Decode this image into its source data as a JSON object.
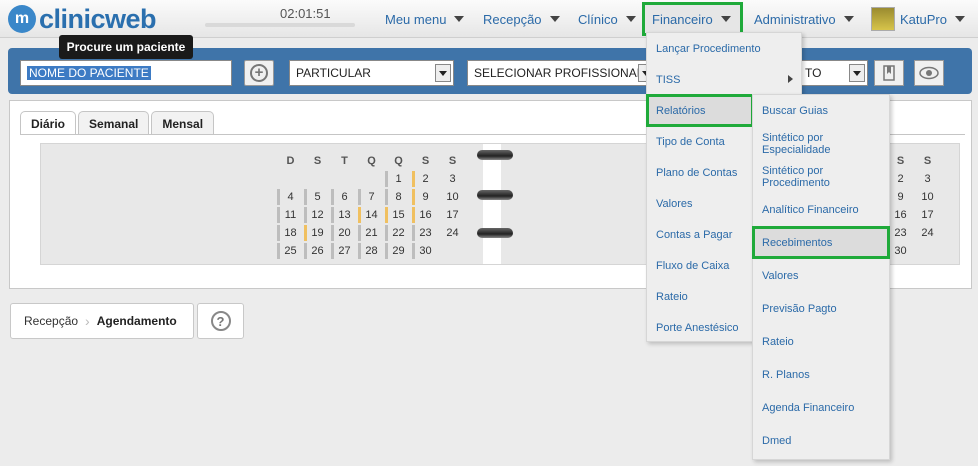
{
  "header": {
    "logo_mark": "m",
    "logo_text": "clinicweb",
    "timer": "02:01:51",
    "nav": [
      {
        "label": "Meu menu"
      },
      {
        "label": "Recepção"
      },
      {
        "label": "Clínico"
      },
      {
        "label": "Financeiro"
      },
      {
        "label": "Administrativo"
      },
      {
        "label": "KatuPro"
      }
    ]
  },
  "tooltip": "Procure um paciente",
  "search": {
    "patient_value": "NOME DO PACIENTE",
    "convenio_value": "PARTICULAR",
    "profissional_value": "SELECIONAR PROFISSIONAL",
    "status_value": "TO"
  },
  "tabs": [
    {
      "label": "Diário"
    },
    {
      "label": "Semanal"
    },
    {
      "label": "Mensal"
    }
  ],
  "calendar": {
    "weekdays": [
      "D",
      "S",
      "T",
      "Q",
      "Q",
      "S",
      "S"
    ],
    "weeks": [
      [
        "",
        "",
        "",
        "",
        "1",
        "2",
        "3"
      ],
      [
        "4",
        "5",
        "6",
        "7",
        "8",
        "9",
        "10"
      ],
      [
        "11",
        "12",
        "13",
        "14",
        "15",
        "16",
        "17"
      ],
      [
        "18",
        "19",
        "20",
        "21",
        "22",
        "23",
        "24"
      ],
      [
        "25",
        "26",
        "27",
        "28",
        "29",
        "30",
        ""
      ]
    ],
    "right_weekdays": [
      "S",
      "S"
    ],
    "right_weeks": [
      [
        "2",
        "3"
      ],
      [
        "9",
        "10"
      ],
      [
        "16",
        "17"
      ],
      [
        "23",
        "24"
      ],
      [
        "30",
        ""
      ]
    ]
  },
  "breadcrumb": {
    "parent": "Recepção",
    "current": "Agendamento"
  },
  "menu_financeiro": [
    {
      "label": "Lançar Procedimento"
    },
    {
      "label": "TISS"
    },
    {
      "label": "Relatórios"
    },
    {
      "label": "Tipo de Conta"
    },
    {
      "label": "Plano de Contas"
    },
    {
      "label": "Valores"
    },
    {
      "label": "Contas a Pagar"
    },
    {
      "label": "Fluxo de Caixa"
    },
    {
      "label": "Rateio"
    },
    {
      "label": "Porte Anestésico"
    }
  ],
  "menu_relatorios": [
    {
      "label": "Buscar Guias"
    },
    {
      "label": "Sintético por Especialidade"
    },
    {
      "label": "Sintético por Procedimento"
    },
    {
      "label": "Analítico Financeiro"
    },
    {
      "label": "Recebimentos"
    },
    {
      "label": "Valores"
    },
    {
      "label": "Previsão Pagto"
    },
    {
      "label": "Rateio"
    },
    {
      "label": "R. Planos"
    },
    {
      "label": "Agenda Financeiro"
    },
    {
      "label": "Dmed"
    }
  ],
  "colors": {
    "accent_blue": "#3f74a9",
    "link_blue": "#2b6aa8",
    "highlight_green": "#1faa3a"
  }
}
